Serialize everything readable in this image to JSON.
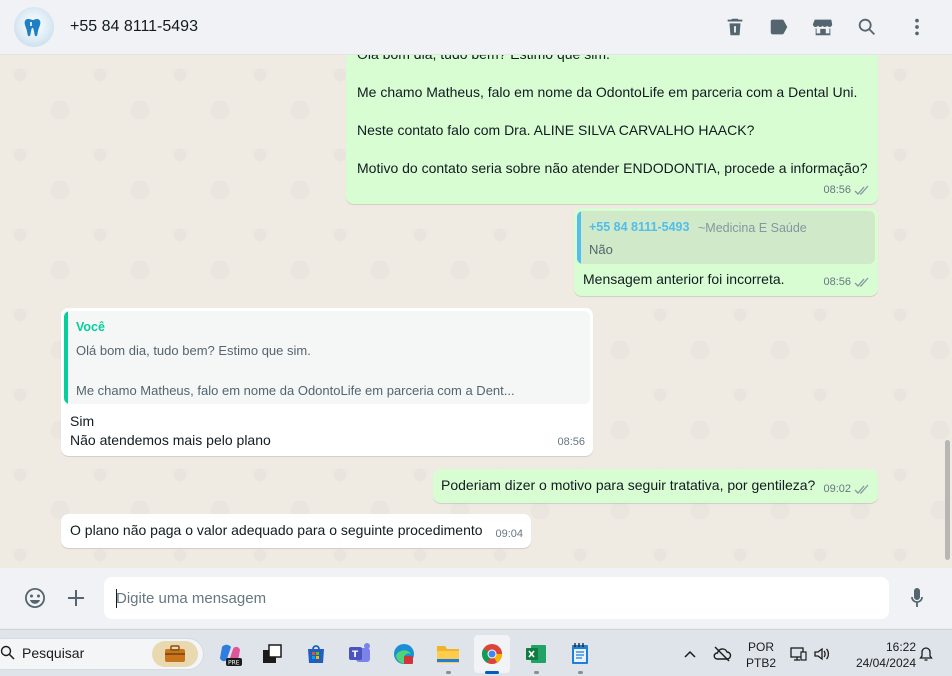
{
  "header": {
    "contact_name": "+55 84 8111-5493",
    "icons": [
      "delete-icon",
      "label-icon",
      "store-icon",
      "search-icon",
      "menu-icon"
    ]
  },
  "messages": {
    "m1": {
      "lines": [
        "Olá bom dia, tudo bem? Estimo que sim.",
        "Me chamo Matheus, falo em nome da OdontoLife em parceria com a Dental Uni.",
        "Neste contato falo com Dra. ALINE SILVA CARVALHO HAACK?",
        "Motivo do contato seria sobre não atender ENDODONTIA, procede a informação?"
      ],
      "time": "08:56"
    },
    "m2": {
      "quote_author": "+55 84 8111-5493",
      "quote_author_name": "~Medicina E Saúde",
      "quote_text": "Não",
      "text": "Mensagem anterior foi incorreta.",
      "time": "08:56"
    },
    "m3": {
      "quote_author": "Você",
      "quote_line1": "Olá bom dia, tudo bem? Estimo que sim.",
      "quote_line2": "Me chamo Matheus, falo em nome da OdontoLife em parceria com a Dent...",
      "line1": "Sim",
      "line2": "Não atendemos mais pelo plano",
      "time": "08:56"
    },
    "m4": {
      "text": "Poderiam dizer o motivo para seguir tratativa, por gentileza?",
      "time": "09:02"
    },
    "m5": {
      "text": "O plano não paga o valor adequado para o seguinte procedimento",
      "time": "09:04"
    }
  },
  "composer": {
    "placeholder": "Digite uma mensagem",
    "value": ""
  },
  "taskbar": {
    "search_label": "Pesquisar",
    "lang_top": "POR",
    "lang_bottom": "PTB2",
    "time": "16:22",
    "date": "24/04/2024"
  },
  "colors": {
    "outgoing_bubble": "#d9fdd3",
    "incoming_bubble": "#ffffff",
    "chat_bg": "#efeae2",
    "quote_blue": "#53bdeb",
    "quote_green": "#06cf9c"
  }
}
